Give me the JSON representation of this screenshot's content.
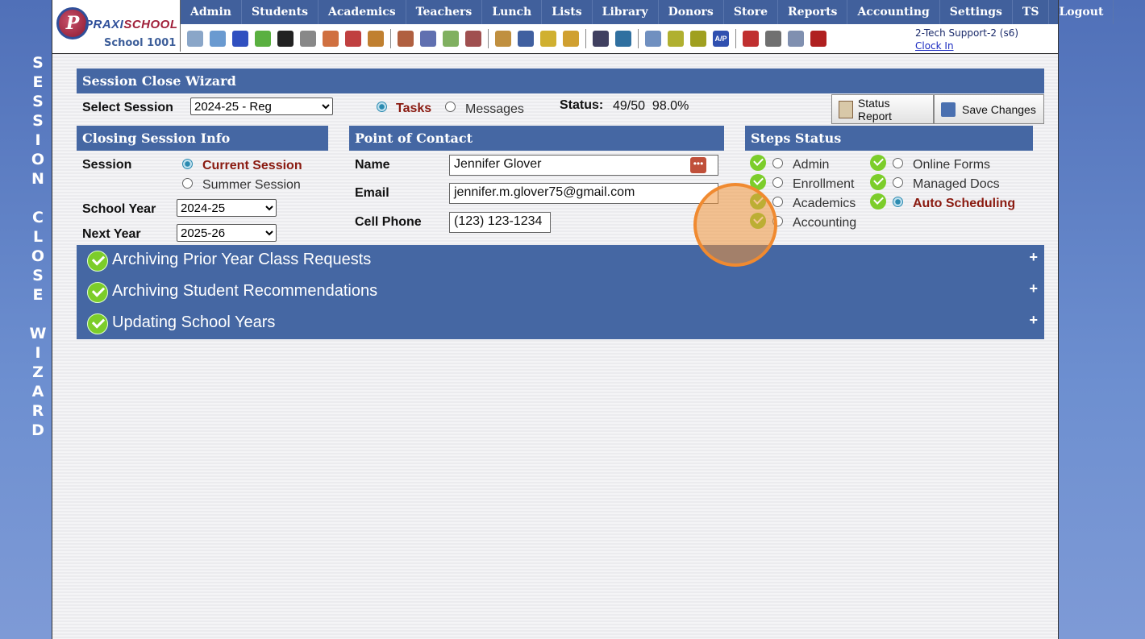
{
  "side_title": [
    "S",
    "E",
    "S",
    "S",
    "I",
    "O",
    "N",
    " ",
    "C",
    "L",
    "O",
    "S",
    "E",
    " ",
    "W",
    "I",
    "Z",
    "A",
    "R",
    "D"
  ],
  "logo": {
    "letter": "P",
    "brand_a": "PRAXI",
    "brand_b": "SCHOOL",
    "school_name": "School 1001"
  },
  "nav": [
    "Admin",
    "Students",
    "Academics",
    "Teachers",
    "Lunch",
    "Lists",
    "Library",
    "Donors",
    "Store",
    "Reports",
    "Accounting",
    "Settings",
    "TS",
    "Logout"
  ],
  "toolbar_icons": [
    {
      "name": "search-icon",
      "color": "#8aa6c8"
    },
    {
      "name": "grid-icon",
      "color": "#6a9ad0"
    },
    {
      "name": "at-icon",
      "color": "#3050c0"
    },
    {
      "name": "chat-icon",
      "color": "#5ab040"
    },
    {
      "name": "phone-icon",
      "color": "#222222"
    },
    {
      "name": "speaker-icon",
      "color": "#888888"
    },
    {
      "name": "calendar-grid-icon",
      "color": "#d07040"
    },
    {
      "name": "calendar-icon",
      "color": "#c04040"
    },
    {
      "name": "megaphone-icon",
      "color": "#c08030"
    },
    {
      "sep": true
    },
    {
      "name": "add-person-icon",
      "color": "#b06040"
    },
    {
      "name": "person-icon",
      "color": "#6070b0"
    },
    {
      "name": "money-icon",
      "color": "#80b060"
    },
    {
      "name": "group-icon",
      "color": "#a05050"
    },
    {
      "sep": true
    },
    {
      "name": "burger-icon",
      "color": "#c09040"
    },
    {
      "name": "book-icon",
      "color": "#4060a0"
    },
    {
      "name": "bell-icon",
      "color": "#d0b030"
    },
    {
      "name": "export-icon",
      "color": "#d0a030"
    },
    {
      "sep": true
    },
    {
      "name": "teacher-icon",
      "color": "#404060"
    },
    {
      "name": "clock-icon",
      "color": "#3070a0"
    },
    {
      "sep": true
    },
    {
      "name": "table-icon",
      "color": "#7090c0"
    },
    {
      "name": "card-icon",
      "color": "#b0b030"
    },
    {
      "name": "printer-icon",
      "color": "#a0a020"
    },
    {
      "name": "ap-icon",
      "color": "#3050b0",
      "label": "A/P"
    },
    {
      "sep": true
    },
    {
      "name": "pdf-icon",
      "color": "#c03030"
    },
    {
      "name": "cash-register-icon",
      "color": "#707070"
    },
    {
      "name": "help-icon",
      "color": "#8090b0"
    },
    {
      "name": "stop-icon",
      "color": "#b02020"
    }
  ],
  "user": {
    "name": "2-Tech Support-2 (s6)",
    "clock_link": "Clock In"
  },
  "wizard": {
    "title": "Session Close Wizard",
    "select_session_label": "Select Session",
    "session_value": "2024-25 - Reg",
    "tasks_label": "Tasks",
    "messages_label": "Messages",
    "status_label": "Status:",
    "status_value": "49/50  98.0%",
    "status_report_btn": "Status Report",
    "save_changes_btn": "Save Changes"
  },
  "closing_info": {
    "title": "Closing Session Info",
    "session_label": "Session",
    "current_session": "Current Session",
    "summer_session": "Summer Session",
    "school_year_label": "School Year",
    "school_year_value": "2024-25",
    "next_year_label": "Next Year",
    "next_year_value": "2025-26"
  },
  "contact": {
    "title": "Point of Contact",
    "name_label": "Name",
    "name_value": "Jennifer Glover",
    "email_label": "Email",
    "email_value": "jennifer.m.glover75@gmail.com",
    "cell_label": "Cell Phone",
    "cell_value": "(123) 123-1234"
  },
  "steps": {
    "title": "Steps Status",
    "left": [
      "Admin",
      "Enrollment",
      "Academics",
      "Accounting"
    ],
    "right": [
      "Online Forms",
      "Managed Docs",
      "Auto Scheduling"
    ],
    "selected": "Auto Scheduling"
  },
  "tasks": [
    {
      "label": "Archiving Prior Year Class Requests",
      "toggle": "+"
    },
    {
      "label": "Archiving Student Recommendations",
      "toggle": "+"
    },
    {
      "label": "Updating School Years",
      "toggle": "+"
    }
  ]
}
